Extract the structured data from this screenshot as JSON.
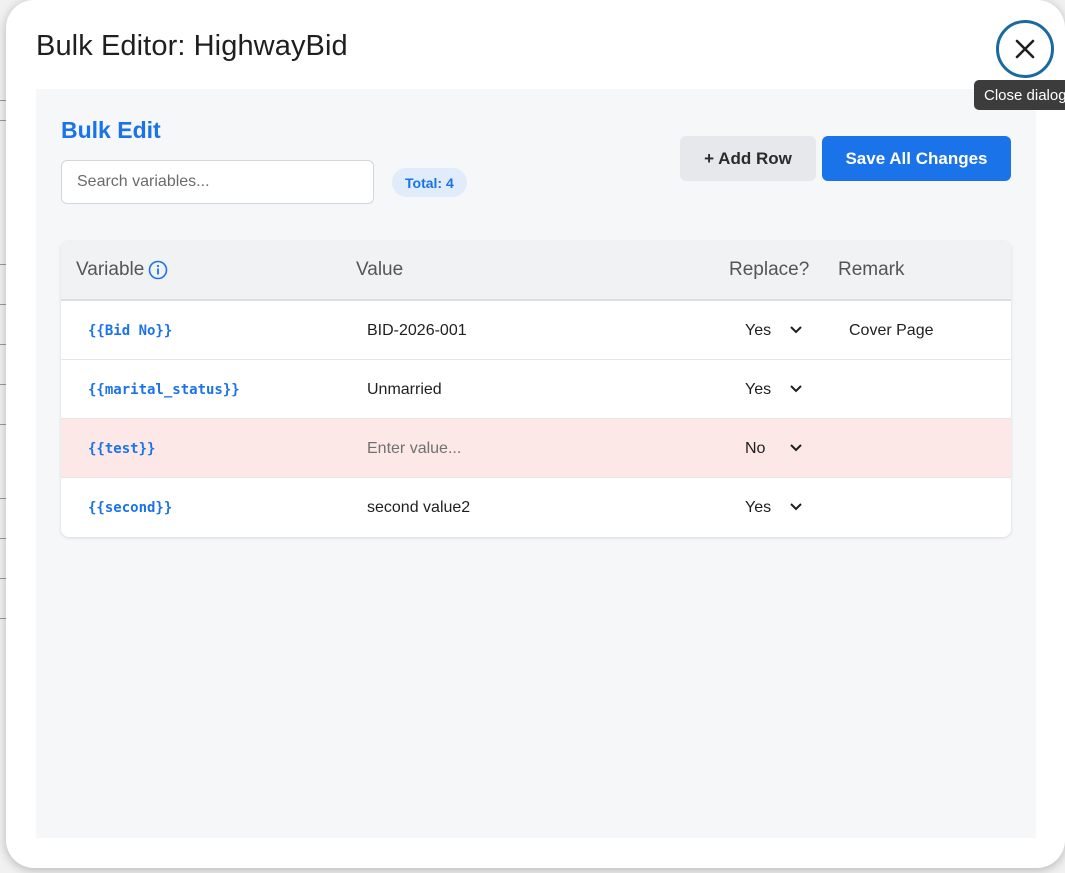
{
  "dialog": {
    "title": "Bulk Editor: HighwayBid",
    "close_tooltip": "Close dialog"
  },
  "panel": {
    "heading": "Bulk Edit",
    "search_placeholder": "Search variables...",
    "total_badge": "Total: 4",
    "add_row_label": "+ Add Row",
    "save_label": "Save All Changes"
  },
  "table": {
    "headers": {
      "variable": "Variable",
      "value": "Value",
      "replace": "Replace?",
      "remark": "Remark"
    },
    "value_placeholder": "Enter value...",
    "rows": [
      {
        "variable": "{{Bid No}}",
        "value": "BID-2026-001",
        "replace": "Yes",
        "remark": "Cover Page"
      },
      {
        "variable": "{{marital_status}}",
        "value": "Unmarried",
        "replace": "Yes",
        "remark": ""
      },
      {
        "variable": "{{test}}",
        "value": "",
        "replace": "No",
        "remark": ""
      },
      {
        "variable": "{{second}}",
        "value": "second value2",
        "replace": "Yes",
        "remark": ""
      }
    ]
  },
  "colors": {
    "accent": "#1a73e8",
    "highlight_row": "#fce8e6",
    "close_ring": "#1a6aa0"
  },
  "icons": {
    "close": "close-icon",
    "info": "info-icon",
    "dropdown": "chevron-down-icon"
  }
}
